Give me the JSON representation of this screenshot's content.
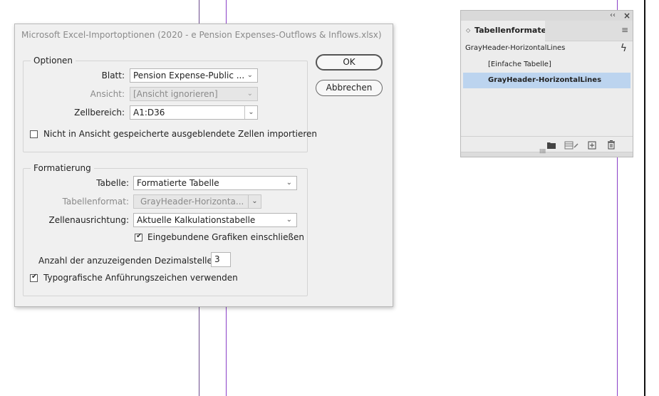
{
  "colors": {
    "guide": "#8a3fc7",
    "guide_dark": "#6b4a8c",
    "selected_row": "#bcd4ef"
  },
  "dialog": {
    "title": "Microsoft Excel-Importoptionen (2020 - e Pension Expenses-Outflows & Inflows.xlsx)",
    "options_legend": "Optionen",
    "blatt_label": "Blatt:",
    "blatt_value": "Pension Expense-Public ...",
    "ansicht_label": "Ansicht:",
    "ansicht_value": "[Ansicht ignorieren]",
    "zellbereich_label": "Zellbereich:",
    "zellbereich_value": "A1:D36",
    "hidden_cells_label": "Nicht in Ansicht gespeicherte ausgeblendete Zellen importieren",
    "hidden_cells_checked": false,
    "format_legend": "Formatierung",
    "tabelle_label": "Tabelle:",
    "tabelle_value": "Formatierte Tabelle",
    "tabellenformat_label": "Tabellenformat:",
    "tabellenformat_value": "GrayHeader-Horizonta...",
    "zellenausrichtung_label": "Zellenausrichtung:",
    "zellenausrichtung_value": "Aktuelle Kalkulationstabelle",
    "inline_graphics_label": "Eingebundene Grafiken einschließen",
    "inline_graphics_checked": true,
    "decimals_label": "Anzahl der anzuzeigenden Dezimalstellen:",
    "decimals_value": "3",
    "typo_quotes_label": "Typografische Anführungszeichen verwenden",
    "typo_quotes_checked": true,
    "ok_label": "OK",
    "cancel_label": "Abbrechen"
  },
  "panel": {
    "collapse_glyph": "‹‹",
    "close_glyph": "×",
    "tab_arrows": "◇",
    "tab_label": "Tabellenformate",
    "menu_glyph": "≡",
    "current_style": "GrayHeader-HorizontalLines",
    "lightning_glyph": "ϟ",
    "items": [
      {
        "label": "[Einfache Tabelle]",
        "selected": false
      },
      {
        "label": "GrayHeader-HorizontalLines",
        "selected": true
      }
    ],
    "grip_glyph": "||||||||"
  }
}
